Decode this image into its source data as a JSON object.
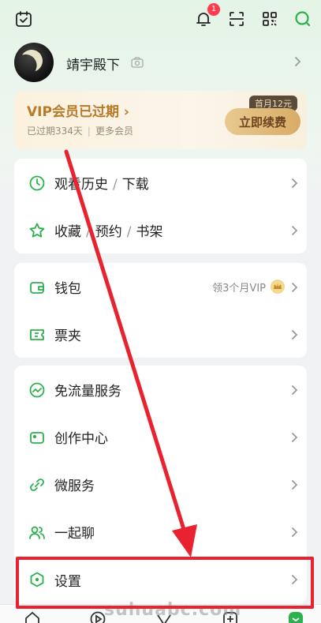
{
  "topbar": {
    "notification_count": "1",
    "icons": [
      "calendar-check-icon",
      "bell-icon",
      "scan-icon",
      "qr-code-icon",
      "search-icon"
    ]
  },
  "profile": {
    "username": "靖宇殿下"
  },
  "vip": {
    "title": "VIP会员已过期 ›",
    "expired_days": "已过期334天",
    "more_members": "更多会员",
    "promo_tag": "首月12元",
    "renew_label": "立即续费"
  },
  "group1": [
    {
      "icon": "clock-icon",
      "parts": [
        "观看历史",
        "下载"
      ]
    },
    {
      "icon": "star-icon",
      "parts": [
        "收藏",
        "预约",
        "书架"
      ]
    }
  ],
  "group2": [
    {
      "icon": "wallet-icon",
      "label": "钱包",
      "right_text": "领3个月VIP"
    },
    {
      "icon": "ticket-icon",
      "label": "票夹"
    }
  ],
  "group3": [
    {
      "icon": "data-free-icon",
      "label": "免流量服务"
    },
    {
      "icon": "video-camera-icon",
      "label": "创作中心"
    },
    {
      "icon": "link-icon",
      "label": "微服务"
    },
    {
      "icon": "people-icon",
      "label": "一起聊"
    },
    {
      "icon": "settings-hexagon-icon",
      "label": "设置"
    }
  ],
  "watermark": "suhuabc.com",
  "colors": {
    "accent_green": "#2bb24c",
    "vip_gold": "#b77a28",
    "annotation_red": "#e8232f"
  }
}
